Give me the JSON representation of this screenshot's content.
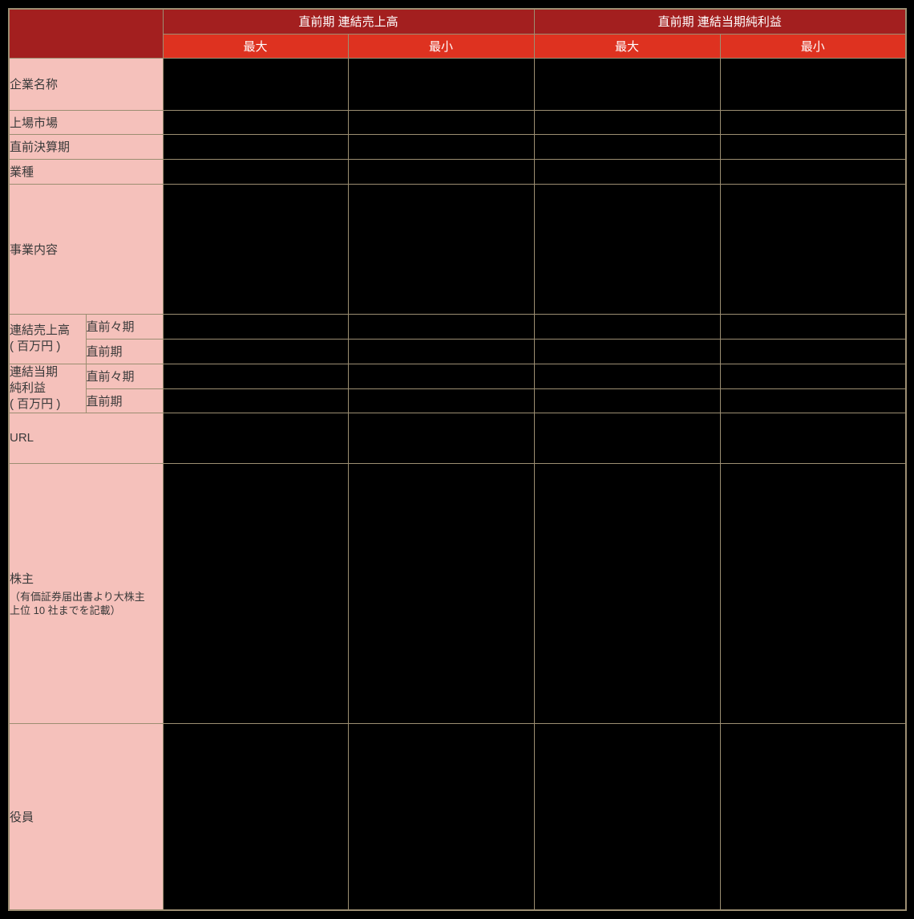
{
  "page": {
    "background": "#000000"
  },
  "table": {
    "colors": {
      "border": "#9C8E72",
      "header_dark_bg": "#A31F1F",
      "header_bright_bg": "#DE3220",
      "header_text": "#FFFFFF",
      "label_bg": "#F5C1BB",
      "label_text": "#3A3A3A",
      "data_cell_bg": "#000000"
    },
    "header": {
      "groups": [
        {
          "label": "直前期 連結売上高",
          "sub": [
            "最大",
            "最小"
          ]
        },
        {
          "label": "直前期 連結当期純利益",
          "sub": [
            "最大",
            "最小"
          ]
        }
      ]
    },
    "rows": {
      "company_name": {
        "label": "企業名称",
        "values": [
          "",
          "",
          "",
          ""
        ]
      },
      "listing_market": {
        "label": "上場市場",
        "values": [
          "",
          "",
          "",
          ""
        ]
      },
      "latest_fiscal_period": {
        "label": "直前決算期",
        "values": [
          "",
          "",
          "",
          ""
        ]
      },
      "industry": {
        "label": "業種",
        "values": [
          "",
          "",
          "",
          ""
        ]
      },
      "business_description": {
        "label": "事業内容",
        "values": [
          "",
          "",
          "",
          ""
        ]
      },
      "consolidated_sales": {
        "label": "連結売上高\n( 百万円 )",
        "sub": [
          "直前々期",
          "直前期"
        ],
        "values_prior2": [
          "",
          "",
          "",
          ""
        ],
        "values_prior1": [
          "",
          "",
          "",
          ""
        ]
      },
      "consolidated_net_income": {
        "label": "連結当期\n純利益\n( 百万円 )",
        "sub": [
          "直前々期",
          "直前期"
        ],
        "values_prior2": [
          "",
          "",
          "",
          ""
        ],
        "values_prior1": [
          "",
          "",
          "",
          ""
        ]
      },
      "url": {
        "label": "URL",
        "values": [
          "",
          "",
          "",
          ""
        ]
      },
      "shareholders": {
        "label": "株主",
        "note": "（有価証券届出書より大株主\n上位 10 社までを記載）",
        "values": [
          "",
          "",
          "",
          ""
        ]
      },
      "officers": {
        "label": "役員",
        "values": [
          "",
          "",
          "",
          ""
        ]
      }
    }
  }
}
